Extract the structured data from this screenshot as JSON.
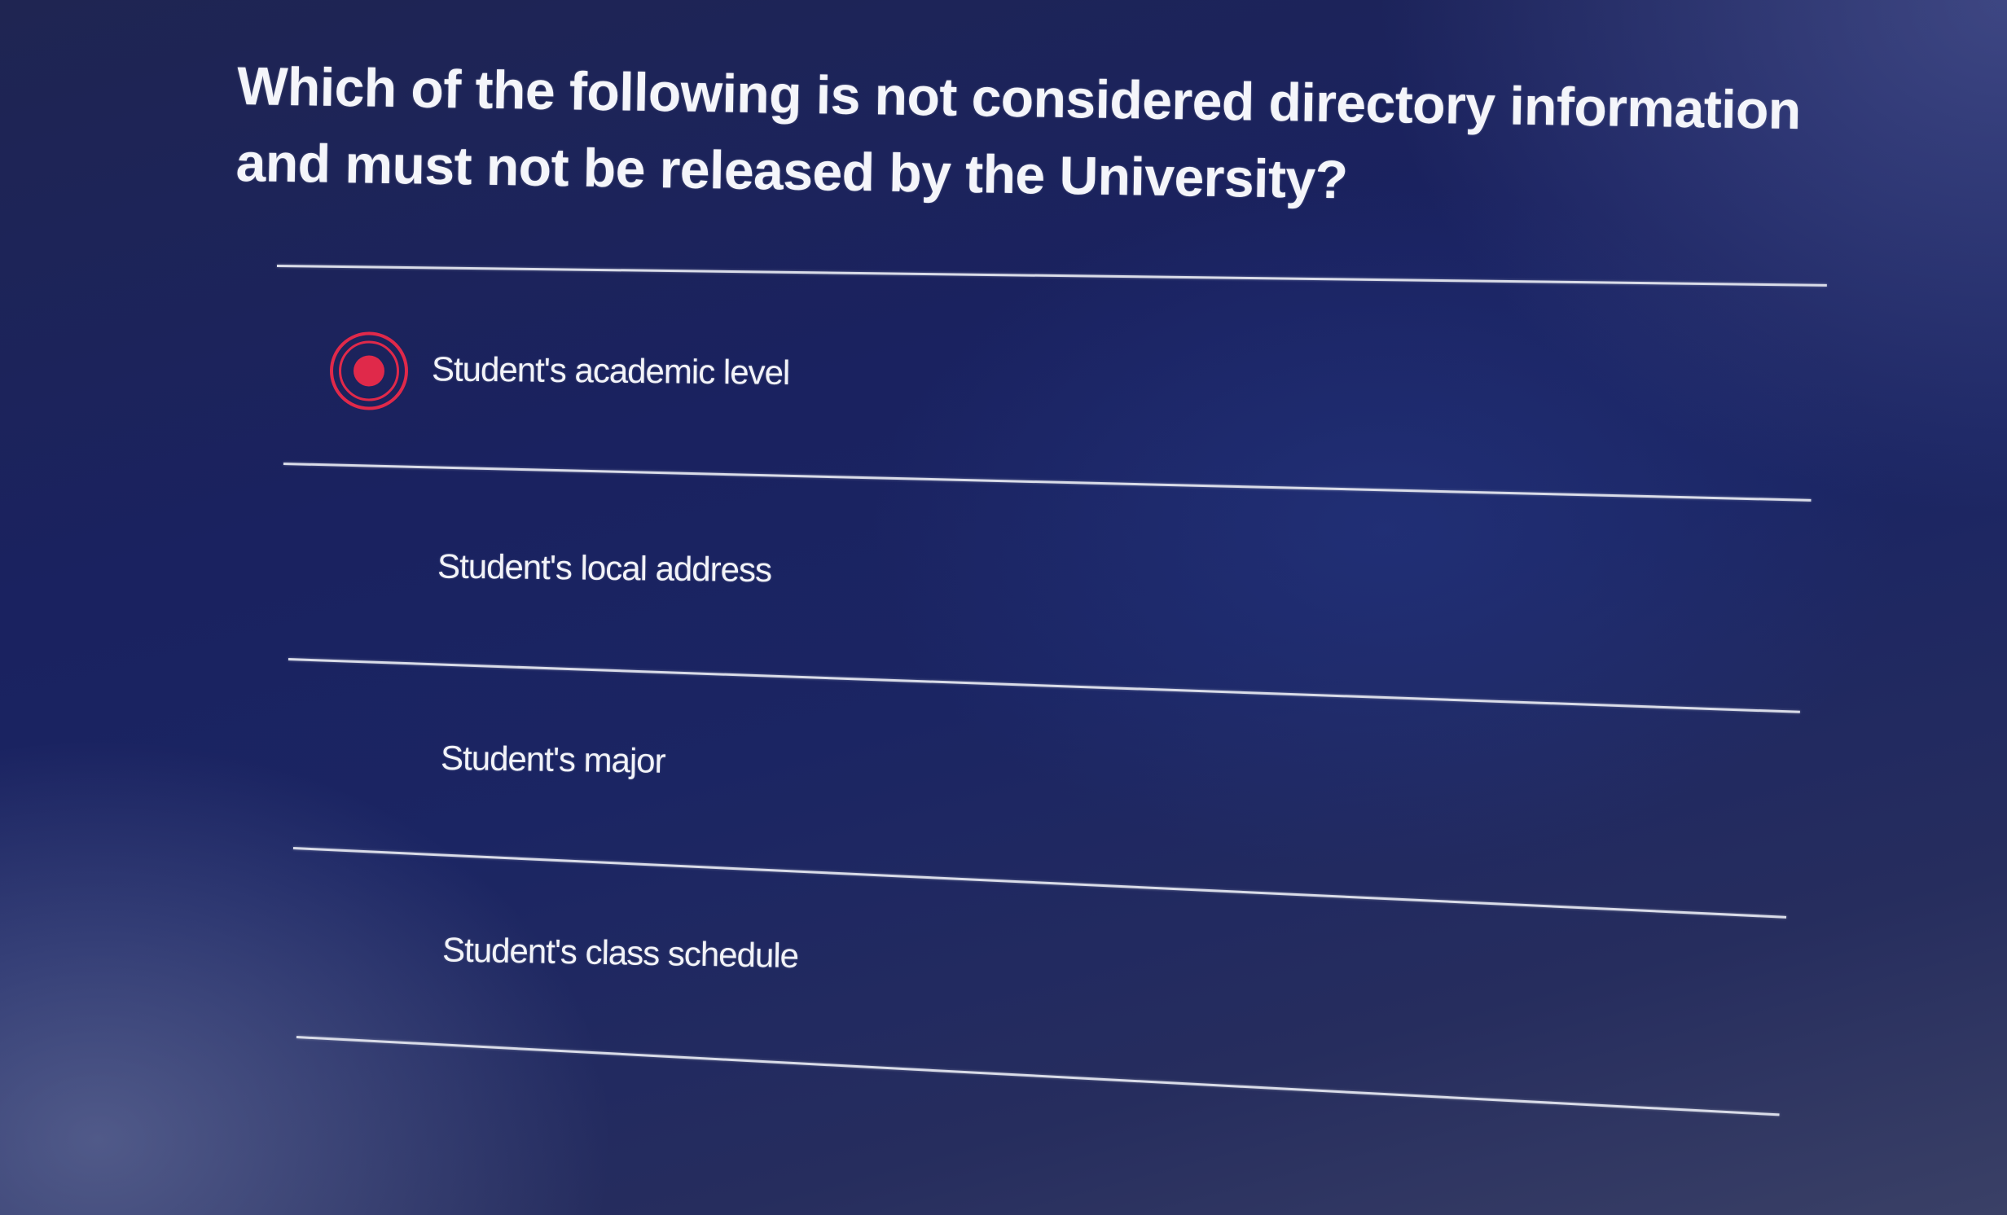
{
  "question": {
    "text": "Which of the following is not considered directory information and must not be released by the University?"
  },
  "options": [
    {
      "label": "Student's academic level",
      "selected": true
    },
    {
      "label": "Student's local address",
      "selected": false
    },
    {
      "label": "Student's major",
      "selected": false
    },
    {
      "label": "Student's class schedule",
      "selected": false
    }
  ],
  "colors": {
    "background": "#1b2563",
    "text": "#f2f3f8",
    "selected_accent": "#e0294a",
    "divider": "#d9dce8"
  },
  "icons": {
    "selected_radio": "radio-selected-icon"
  }
}
